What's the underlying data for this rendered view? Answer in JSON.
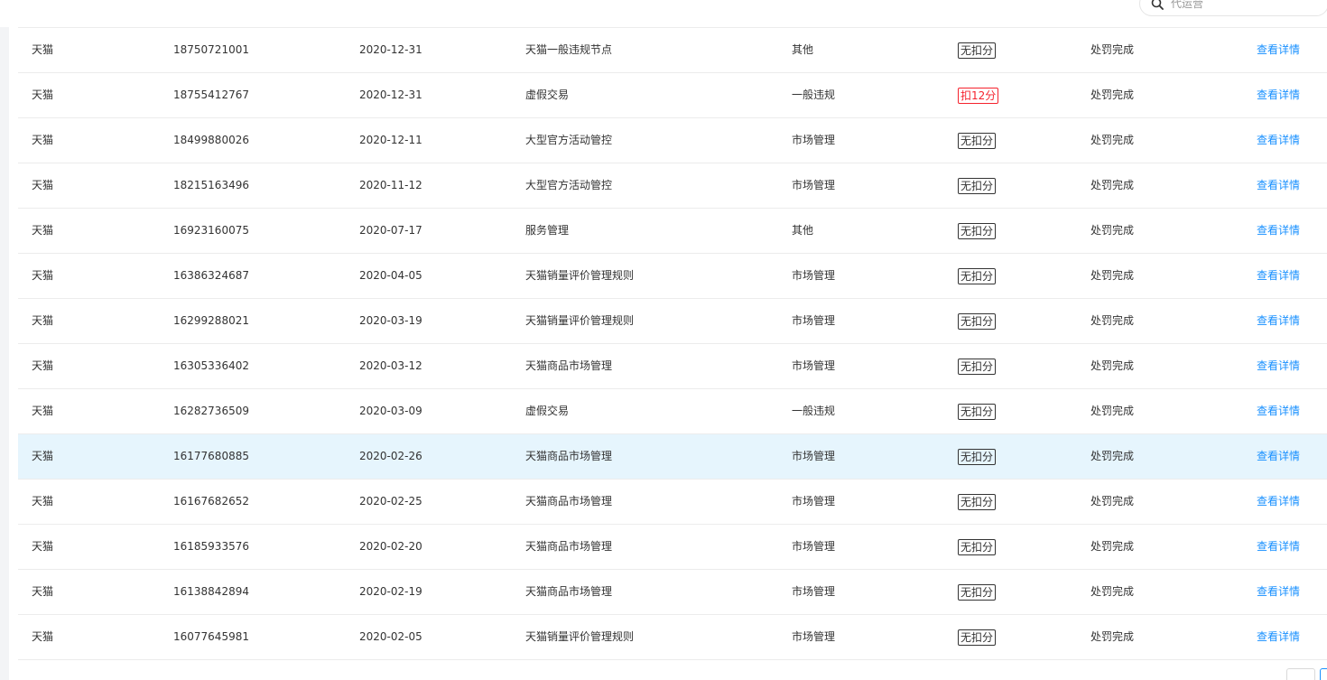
{
  "search": {
    "placeholder": "代运营"
  },
  "colors": {
    "link": "#1890ff",
    "penalty": "#f5222d",
    "row_highlight": "#e6f5fd"
  },
  "rows": [
    {
      "platform": "天猫",
      "id": "18750721001",
      "date": "2020-12-31",
      "reason": "天猫一般违规节点",
      "type": "其他",
      "points": "无扣分",
      "points_style": "normal",
      "status": "处罚完成",
      "action": "查看详情"
    },
    {
      "platform": "天猫",
      "id": "18755412767",
      "date": "2020-12-31",
      "reason": "虚假交易",
      "type": "一般违规",
      "points": "扣12分",
      "points_style": "red",
      "status": "处罚完成",
      "action": "查看详情"
    },
    {
      "platform": "天猫",
      "id": "18499880026",
      "date": "2020-12-11",
      "reason": "大型官方活动管控",
      "type": "市场管理",
      "points": "无扣分",
      "points_style": "normal",
      "status": "处罚完成",
      "action": "查看详情"
    },
    {
      "platform": "天猫",
      "id": "18215163496",
      "date": "2020-11-12",
      "reason": "大型官方活动管控",
      "type": "市场管理",
      "points": "无扣分",
      "points_style": "normal",
      "status": "处罚完成",
      "action": "查看详情"
    },
    {
      "platform": "天猫",
      "id": "16923160075",
      "date": "2020-07-17",
      "reason": "服务管理",
      "type": "其他",
      "points": "无扣分",
      "points_style": "normal",
      "status": "处罚完成",
      "action": "查看详情"
    },
    {
      "platform": "天猫",
      "id": "16386324687",
      "date": "2020-04-05",
      "reason": "天猫销量评价管理规则",
      "type": "市场管理",
      "points": "无扣分",
      "points_style": "normal",
      "status": "处罚完成",
      "action": "查看详情"
    },
    {
      "platform": "天猫",
      "id": "16299288021",
      "date": "2020-03-19",
      "reason": "天猫销量评价管理规则",
      "type": "市场管理",
      "points": "无扣分",
      "points_style": "normal",
      "status": "处罚完成",
      "action": "查看详情"
    },
    {
      "platform": "天猫",
      "id": "16305336402",
      "date": "2020-03-12",
      "reason": "天猫商品市场管理",
      "type": "市场管理",
      "points": "无扣分",
      "points_style": "normal",
      "status": "处罚完成",
      "action": "查看详情"
    },
    {
      "platform": "天猫",
      "id": "16282736509",
      "date": "2020-03-09",
      "reason": "虚假交易",
      "type": "一般违规",
      "points": "无扣分",
      "points_style": "normal",
      "status": "处罚完成",
      "action": "查看详情"
    },
    {
      "platform": "天猫",
      "id": "16177680885",
      "date": "2020-02-26",
      "reason": "天猫商品市场管理",
      "type": "市场管理",
      "points": "无扣分",
      "points_style": "normal",
      "status": "处罚完成",
      "action": "查看详情",
      "highlight": true
    },
    {
      "platform": "天猫",
      "id": "16167682652",
      "date": "2020-02-25",
      "reason": "天猫商品市场管理",
      "type": "市场管理",
      "points": "无扣分",
      "points_style": "normal",
      "status": "处罚完成",
      "action": "查看详情"
    },
    {
      "platform": "天猫",
      "id": "16185933576",
      "date": "2020-02-20",
      "reason": "天猫商品市场管理",
      "type": "市场管理",
      "points": "无扣分",
      "points_style": "normal",
      "status": "处罚完成",
      "action": "查看详情"
    },
    {
      "platform": "天猫",
      "id": "16138842894",
      "date": "2020-02-19",
      "reason": "天猫商品市场管理",
      "type": "市场管理",
      "points": "无扣分",
      "points_style": "normal",
      "status": "处罚完成",
      "action": "查看详情"
    },
    {
      "platform": "天猫",
      "id": "16077645981",
      "date": "2020-02-05",
      "reason": "天猫销量评价管理规则",
      "type": "市场管理",
      "points": "无扣分",
      "points_style": "normal",
      "status": "处罚完成",
      "action": "查看详情"
    }
  ]
}
